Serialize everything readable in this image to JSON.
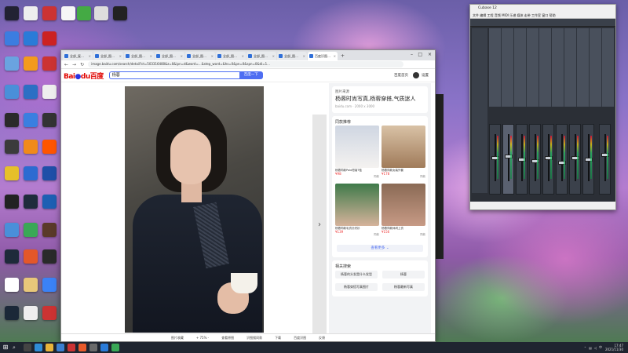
{
  "browser": {
    "tabs": [
      {
        "label": "全部_复…"
      },
      {
        "label": "全部_图…"
      },
      {
        "label": "全部_图…"
      },
      {
        "label": "全部_图…"
      },
      {
        "label": "全部_图…"
      },
      {
        "label": "全部_图…"
      },
      {
        "label": "全部_图…"
      },
      {
        "label": "全部_图…"
      },
      {
        "label": "百度识图…"
      }
    ],
    "url": "image.baidu.com/search/detail?ct=503316480&z=0&ipn=d&word=...&step_word=&hs=0&pn=0&spn=0&di=1...",
    "logo_text": "Bai",
    "logo_text_blue": "du",
    "logo_suffix": "百度",
    "search_value": "杨蓉",
    "search_button": "百度一下",
    "user_link": "百度首页",
    "user_name": "设置"
  },
  "sidepanel": {
    "source_label": "图片来源",
    "source_title": "杨蓉时尚写真,杨蓉穿搭,气质迷人",
    "source_meta": "baidu.com · 2000 x 3000",
    "related_header": "同款推荐",
    "products": [
      {
        "caption": "杨蓉同款Polo短袖T恤",
        "price": "¥98",
        "more": "同款"
      },
      {
        "caption": "杨蓉同款女装外套",
        "price": "¥178",
        "more": "同款"
      },
      {
        "caption": "杨蓉同款毛衣针织衫",
        "price": "¥139",
        "more": "同款"
      },
      {
        "caption": "杨蓉同款休闲上衣",
        "price": "¥156",
        "more": "同款"
      }
    ],
    "more_button": "查看更多 ⌄",
    "related_search_header": "相关搜索",
    "chips": [
      "杨蓉的头发是什么发型",
      "杨蓉",
      "杨蓉穿搭写真图片",
      "杨蓉最新写真"
    ]
  },
  "statusbar": {
    "items": [
      "图片收藏",
      "+ 75% -",
      "查看原图",
      "识图搜同款",
      "下载",
      "百度识图",
      "反馈"
    ]
  },
  "daw": {
    "title": "Cubase 12",
    "menu": "文件 编辑 工程 音频 MIDI 乐谱 媒体 走带 工作室 窗口 帮助"
  },
  "taskbar": {
    "time": "17:47",
    "date": "2021/11/30"
  },
  "colors": {
    "baidu_red": "#e10602",
    "baidu_blue": "#2932e1",
    "accent": "#4e6ef2"
  }
}
